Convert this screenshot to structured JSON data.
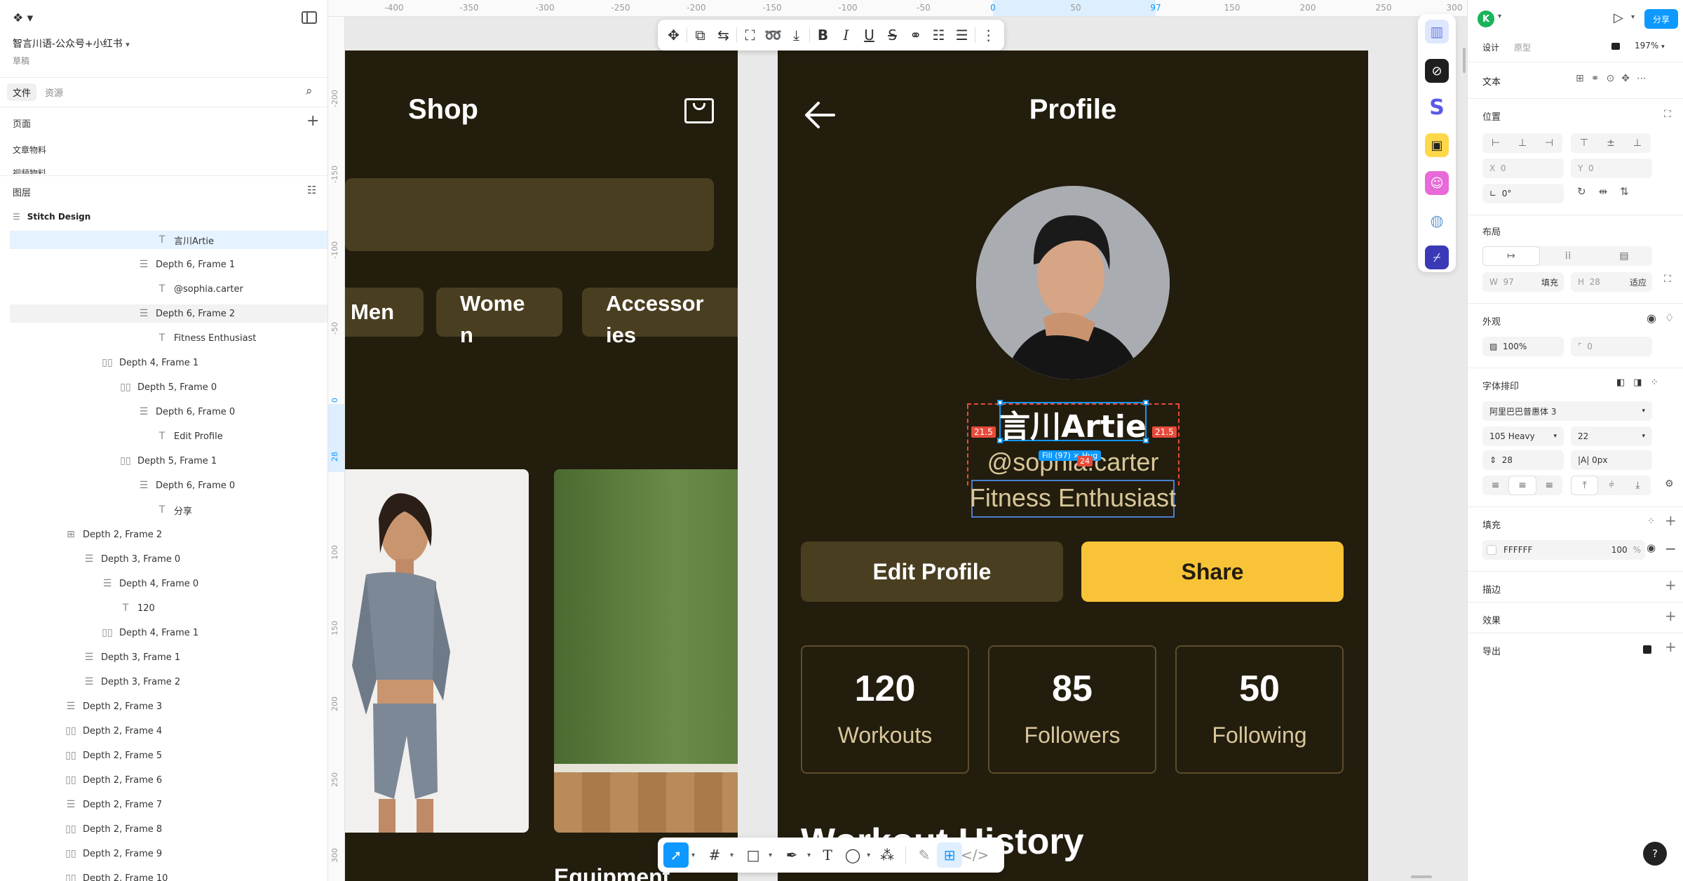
{
  "file": {
    "name": "智言川语-公众号+小红书",
    "status": "草稿"
  },
  "left_tabs": [
    "文件",
    "资源"
  ],
  "pages": {
    "title": "页面",
    "items": [
      "文章物料",
      "视频物料"
    ]
  },
  "layers": {
    "title": "图层",
    "root": "Stitch Design",
    "items": [
      {
        "label": "言川Artie",
        "indent": 6,
        "glyph": "T",
        "selected": true
      },
      {
        "label": "Depth 6, Frame 1",
        "indent": 5,
        "glyph": "☰"
      },
      {
        "label": "@sophia.carter",
        "indent": 6,
        "glyph": "T"
      },
      {
        "label": "Depth 6, Frame 2",
        "indent": 5,
        "glyph": "☰",
        "hover": true
      },
      {
        "label": "Fitness Enthusiast",
        "indent": 6,
        "glyph": "T"
      },
      {
        "label": "Depth 4, Frame 1",
        "indent": 3,
        "glyph": "▯▯"
      },
      {
        "label": "Depth 5, Frame 0",
        "indent": 4,
        "glyph": "▯▯"
      },
      {
        "label": "Depth 6, Frame 0",
        "indent": 5,
        "glyph": "☰"
      },
      {
        "label": "Edit Profile",
        "indent": 6,
        "glyph": "T"
      },
      {
        "label": "Depth 5, Frame 1",
        "indent": 4,
        "glyph": "▯▯"
      },
      {
        "label": "Depth 6, Frame 0",
        "indent": 5,
        "glyph": "☰"
      },
      {
        "label": "分享",
        "indent": 6,
        "glyph": "T"
      },
      {
        "label": "Depth 2, Frame 2",
        "indent": 1,
        "glyph": "⊞"
      },
      {
        "label": "Depth 3, Frame 0",
        "indent": 2,
        "glyph": "☰"
      },
      {
        "label": "Depth 4, Frame 0",
        "indent": 3,
        "glyph": "☰"
      },
      {
        "label": "120",
        "indent": 4,
        "glyph": "T"
      },
      {
        "label": "Depth 4, Frame 1",
        "indent": 3,
        "glyph": "▯▯"
      },
      {
        "label": "Depth 3, Frame 1",
        "indent": 2,
        "glyph": "☰"
      },
      {
        "label": "Depth 3, Frame 2",
        "indent": 2,
        "glyph": "☰"
      },
      {
        "label": "Depth 2, Frame 3",
        "indent": 1,
        "glyph": "☰"
      },
      {
        "label": "Depth 2, Frame 4",
        "indent": 1,
        "glyph": "▯▯"
      },
      {
        "label": "Depth 2, Frame 5",
        "indent": 1,
        "glyph": "▯▯"
      },
      {
        "label": "Depth 2, Frame 6",
        "indent": 1,
        "glyph": "▯▯"
      },
      {
        "label": "Depth 2, Frame 7",
        "indent": 1,
        "glyph": "☰"
      },
      {
        "label": "Depth 2, Frame 8",
        "indent": 1,
        "glyph": "▯▯"
      },
      {
        "label": "Depth 2, Frame 9",
        "indent": 1,
        "glyph": "▯▯"
      },
      {
        "label": "Depth 2, Frame 10",
        "indent": 1,
        "glyph": "▯▯"
      }
    ]
  },
  "ruler_top": [
    "-400",
    "-350",
    "-300",
    "-250",
    "-200",
    "-150",
    "-100",
    "-50",
    "0",
    "50",
    "97",
    "150",
    "200",
    "250",
    "300"
  ],
  "ruler_left": [
    "-200",
    "-150",
    "-100",
    "-50",
    "0",
    "28",
    "100",
    "150",
    "200",
    "250",
    "300"
  ],
  "shop": {
    "title": "Shop",
    "tabs": [
      "Men",
      "Wome\nn",
      "Accessor\nies"
    ],
    "section": "Equipment"
  },
  "profile": {
    "title": "Profile",
    "name": "言川Artie",
    "handle": "@sophia.carter",
    "bio": "Fitness Enthusiast",
    "edit_label": "Edit Profile",
    "share_label": "Share",
    "stats": [
      {
        "value": "120",
        "label": "Workouts"
      },
      {
        "value": "85",
        "label": "Followers"
      },
      {
        "value": "50",
        "label": "Following"
      }
    ],
    "section": "Workout History"
  },
  "selection": {
    "spacing_left": "21.5",
    "spacing_right": "21.5",
    "size_label": "Fill (97) × Hug",
    "gap_label": "24"
  },
  "right": {
    "avatar": "K",
    "share": "分享",
    "tabs": [
      "设计",
      "原型"
    ],
    "zoom": "197%",
    "text_title": "文本",
    "position": {
      "title": "位置",
      "x": "0",
      "y": "0",
      "rotation": "0°"
    },
    "layout": {
      "title": "布局",
      "w": "97",
      "w_mode": "填充",
      "h": "28",
      "h_mode": "适应"
    },
    "appearance": {
      "title": "外观",
      "opacity": "100%",
      "radius": "0"
    },
    "typography": {
      "title": "字体排印",
      "font": "阿里巴巴普惠体 3",
      "weight": "105 Heavy",
      "size": "22",
      "line_height": "28",
      "letter_spacing": "0px"
    },
    "fill": {
      "title": "填充",
      "hex": "FFFFFF",
      "opacity": "100",
      "unit": "%"
    },
    "stroke": "描边",
    "effects": "效果",
    "export": "导出",
    "help": "?"
  },
  "colors": {
    "accent": "#0d99ff",
    "frame_bg": "#231d0e",
    "chip_bg": "#4a3e21",
    "share_yellow": "#f8c337",
    "stat_label": "#d8c79a"
  }
}
